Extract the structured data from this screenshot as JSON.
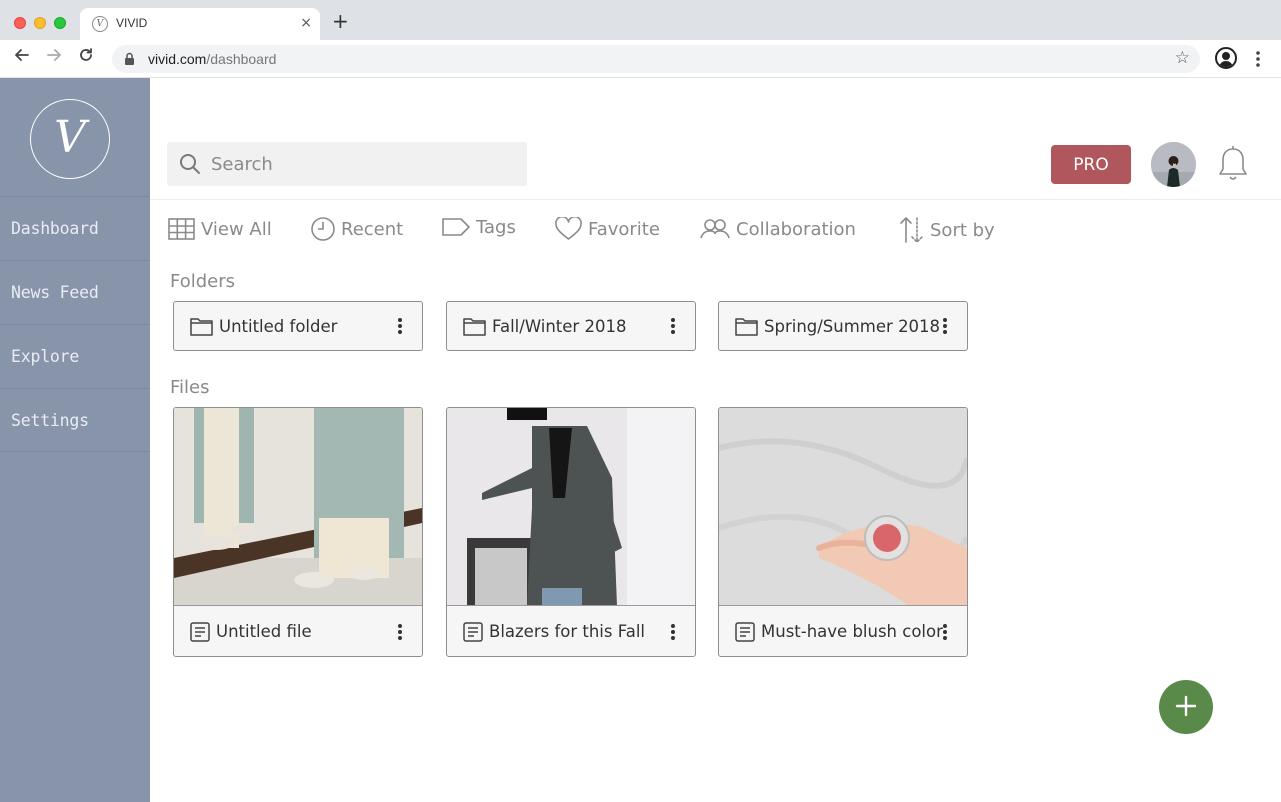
{
  "browser": {
    "tab_title": "VIVID",
    "tab_favicon": "V",
    "url_domain": "vivid.com",
    "url_path": "/dashboard",
    "new_tab_label": "+",
    "tab_close": "×"
  },
  "sidebar": {
    "logo_letter": "V",
    "items": [
      {
        "label": "Dashboard"
      },
      {
        "label": "News Feed"
      },
      {
        "label": "Explore"
      },
      {
        "label": "Settings"
      }
    ]
  },
  "header": {
    "search_placeholder": "Search",
    "pro_label": "PRO"
  },
  "filters": [
    {
      "label": "View All",
      "icon": "grid-icon"
    },
    {
      "label": "Recent",
      "icon": "clock-icon"
    },
    {
      "label": "Tags",
      "icon": "tag-icon"
    },
    {
      "label": "Favorite",
      "icon": "heart-icon"
    },
    {
      "label": "Collaboration",
      "icon": "users-icon"
    },
    {
      "label": "Sort by",
      "icon": "sort-icon"
    }
  ],
  "folders_title": "Folders",
  "folders": [
    {
      "name": "Untitled folder"
    },
    {
      "name": "Fall/Winter 2018"
    },
    {
      "name": "Spring/Summer 2018"
    }
  ],
  "files_title": "Files",
  "files": [
    {
      "name": "Untitled file"
    },
    {
      "name": "Blazers for this Fall"
    },
    {
      "name": "Must-have blush color"
    }
  ],
  "colors": {
    "sidebar": "#8794a9",
    "pro": "#b0575e",
    "fab": "#5a8a4a"
  }
}
